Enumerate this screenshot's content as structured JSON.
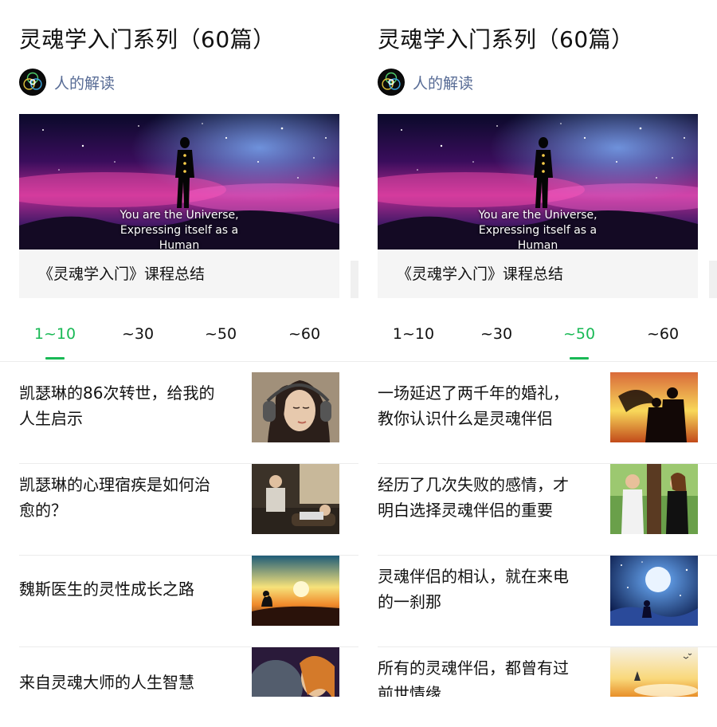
{
  "panels": [
    {
      "title": "灵魂学入门系列（60篇）",
      "author": "人的解读",
      "cover_caption": [
        "You are the Universe,",
        "Expressing itself as a",
        "Human"
      ],
      "card_title": "《灵魂学入门》课程总结",
      "tabs": [
        "1~10",
        "~30",
        "~50",
        "~60"
      ],
      "active_tab": 0,
      "items": [
        {
          "title_lines": [
            "凯瑟琳的86次转世，给我的",
            "人生启示"
          ],
          "thumb": "woman-headphones"
        },
        {
          "title_lines": [
            "凯瑟琳的心理宿疾是如何治",
            "愈的？"
          ],
          "thumb": "therapy-session"
        },
        {
          "title_lines": [
            "魏斯医生的灵性成长之路"
          ],
          "thumb": "meditation-sunset"
        },
        {
          "title_lines": [
            "来自灵魂大师的人生智慧"
          ],
          "thumb": "cosmic-face"
        }
      ]
    },
    {
      "title": "灵魂学入门系列（60篇）",
      "author": "人的解读",
      "cover_caption": [
        "You are the Universe,",
        "Expressing itself as a",
        "Human"
      ],
      "card_title": "《灵魂学入门》课程总结",
      "tabs": [
        "1~10",
        "~30",
        "~50",
        "~60"
      ],
      "active_tab": 2,
      "items": [
        {
          "title_lines": [
            "一场延迟了两千年的婚礼，",
            "教你认识什么是灵魂伴侣"
          ],
          "thumb": "couple-silhouette"
        },
        {
          "title_lines": [
            "经历了几次失败的感情，才",
            "明白选择灵魂伴侣的重要"
          ],
          "thumb": "couple-tree"
        },
        {
          "title_lines": [
            "灵魂伴侣的相认，就在来电",
            "的一刹那"
          ],
          "thumb": "moon-night"
        },
        {
          "title_lines": [
            "所有的灵魂伴侣，都曾有过",
            "前世情缘"
          ],
          "thumb": "sunset-clouds"
        }
      ]
    }
  ],
  "colors": {
    "accent": "#19b955",
    "author_link": "#576b95",
    "divider": "#ececec",
    "card_bg": "#f5f5f5"
  }
}
